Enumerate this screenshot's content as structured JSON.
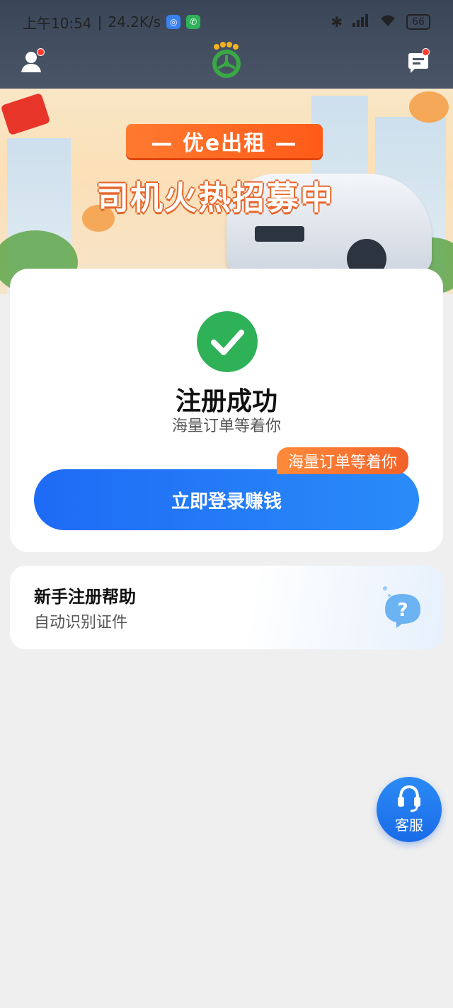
{
  "status_bar": {
    "time": "上午10:54",
    "net_speed": "24.2K/s",
    "battery": "66"
  },
  "header": {
    "icons": [
      "user-icon",
      "app-logo",
      "message-icon"
    ]
  },
  "banner": {
    "brand": "— 优e出租 —",
    "headline": "司机火热招募中"
  },
  "result": {
    "title": "注册成功",
    "subtitle": "海量订单等着你",
    "badge": "海量订单等着你",
    "button_label": "立即登录赚钱"
  },
  "help": {
    "title": "新手注册帮助",
    "subtitle": "自动识别证件"
  },
  "customer_service": {
    "label": "客服"
  },
  "colors": {
    "primary": "#1e6bf5",
    "success": "#2fb158",
    "accent": "#f2622a",
    "header_bg": "#3a4658"
  }
}
